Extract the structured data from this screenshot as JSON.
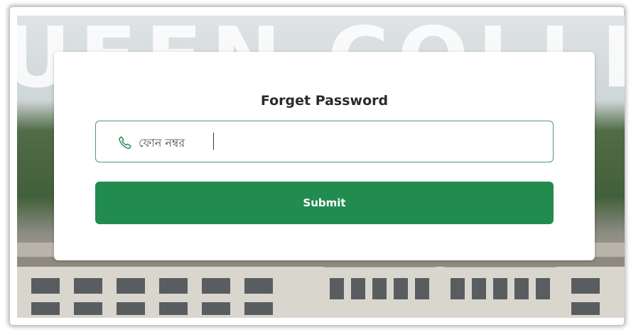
{
  "background": {
    "banner_text": "UEEN COLLEGE"
  },
  "form": {
    "title": "Forget Password",
    "phone_placeholder": "ফোন নম্বর",
    "phone_value": "",
    "submit_label": "Submit"
  },
  "icons": {
    "phone": "phone-icon"
  },
  "colors": {
    "accent": "#228b4f",
    "field_border": "#45a06a",
    "title_text": "#2b2b2b"
  }
}
